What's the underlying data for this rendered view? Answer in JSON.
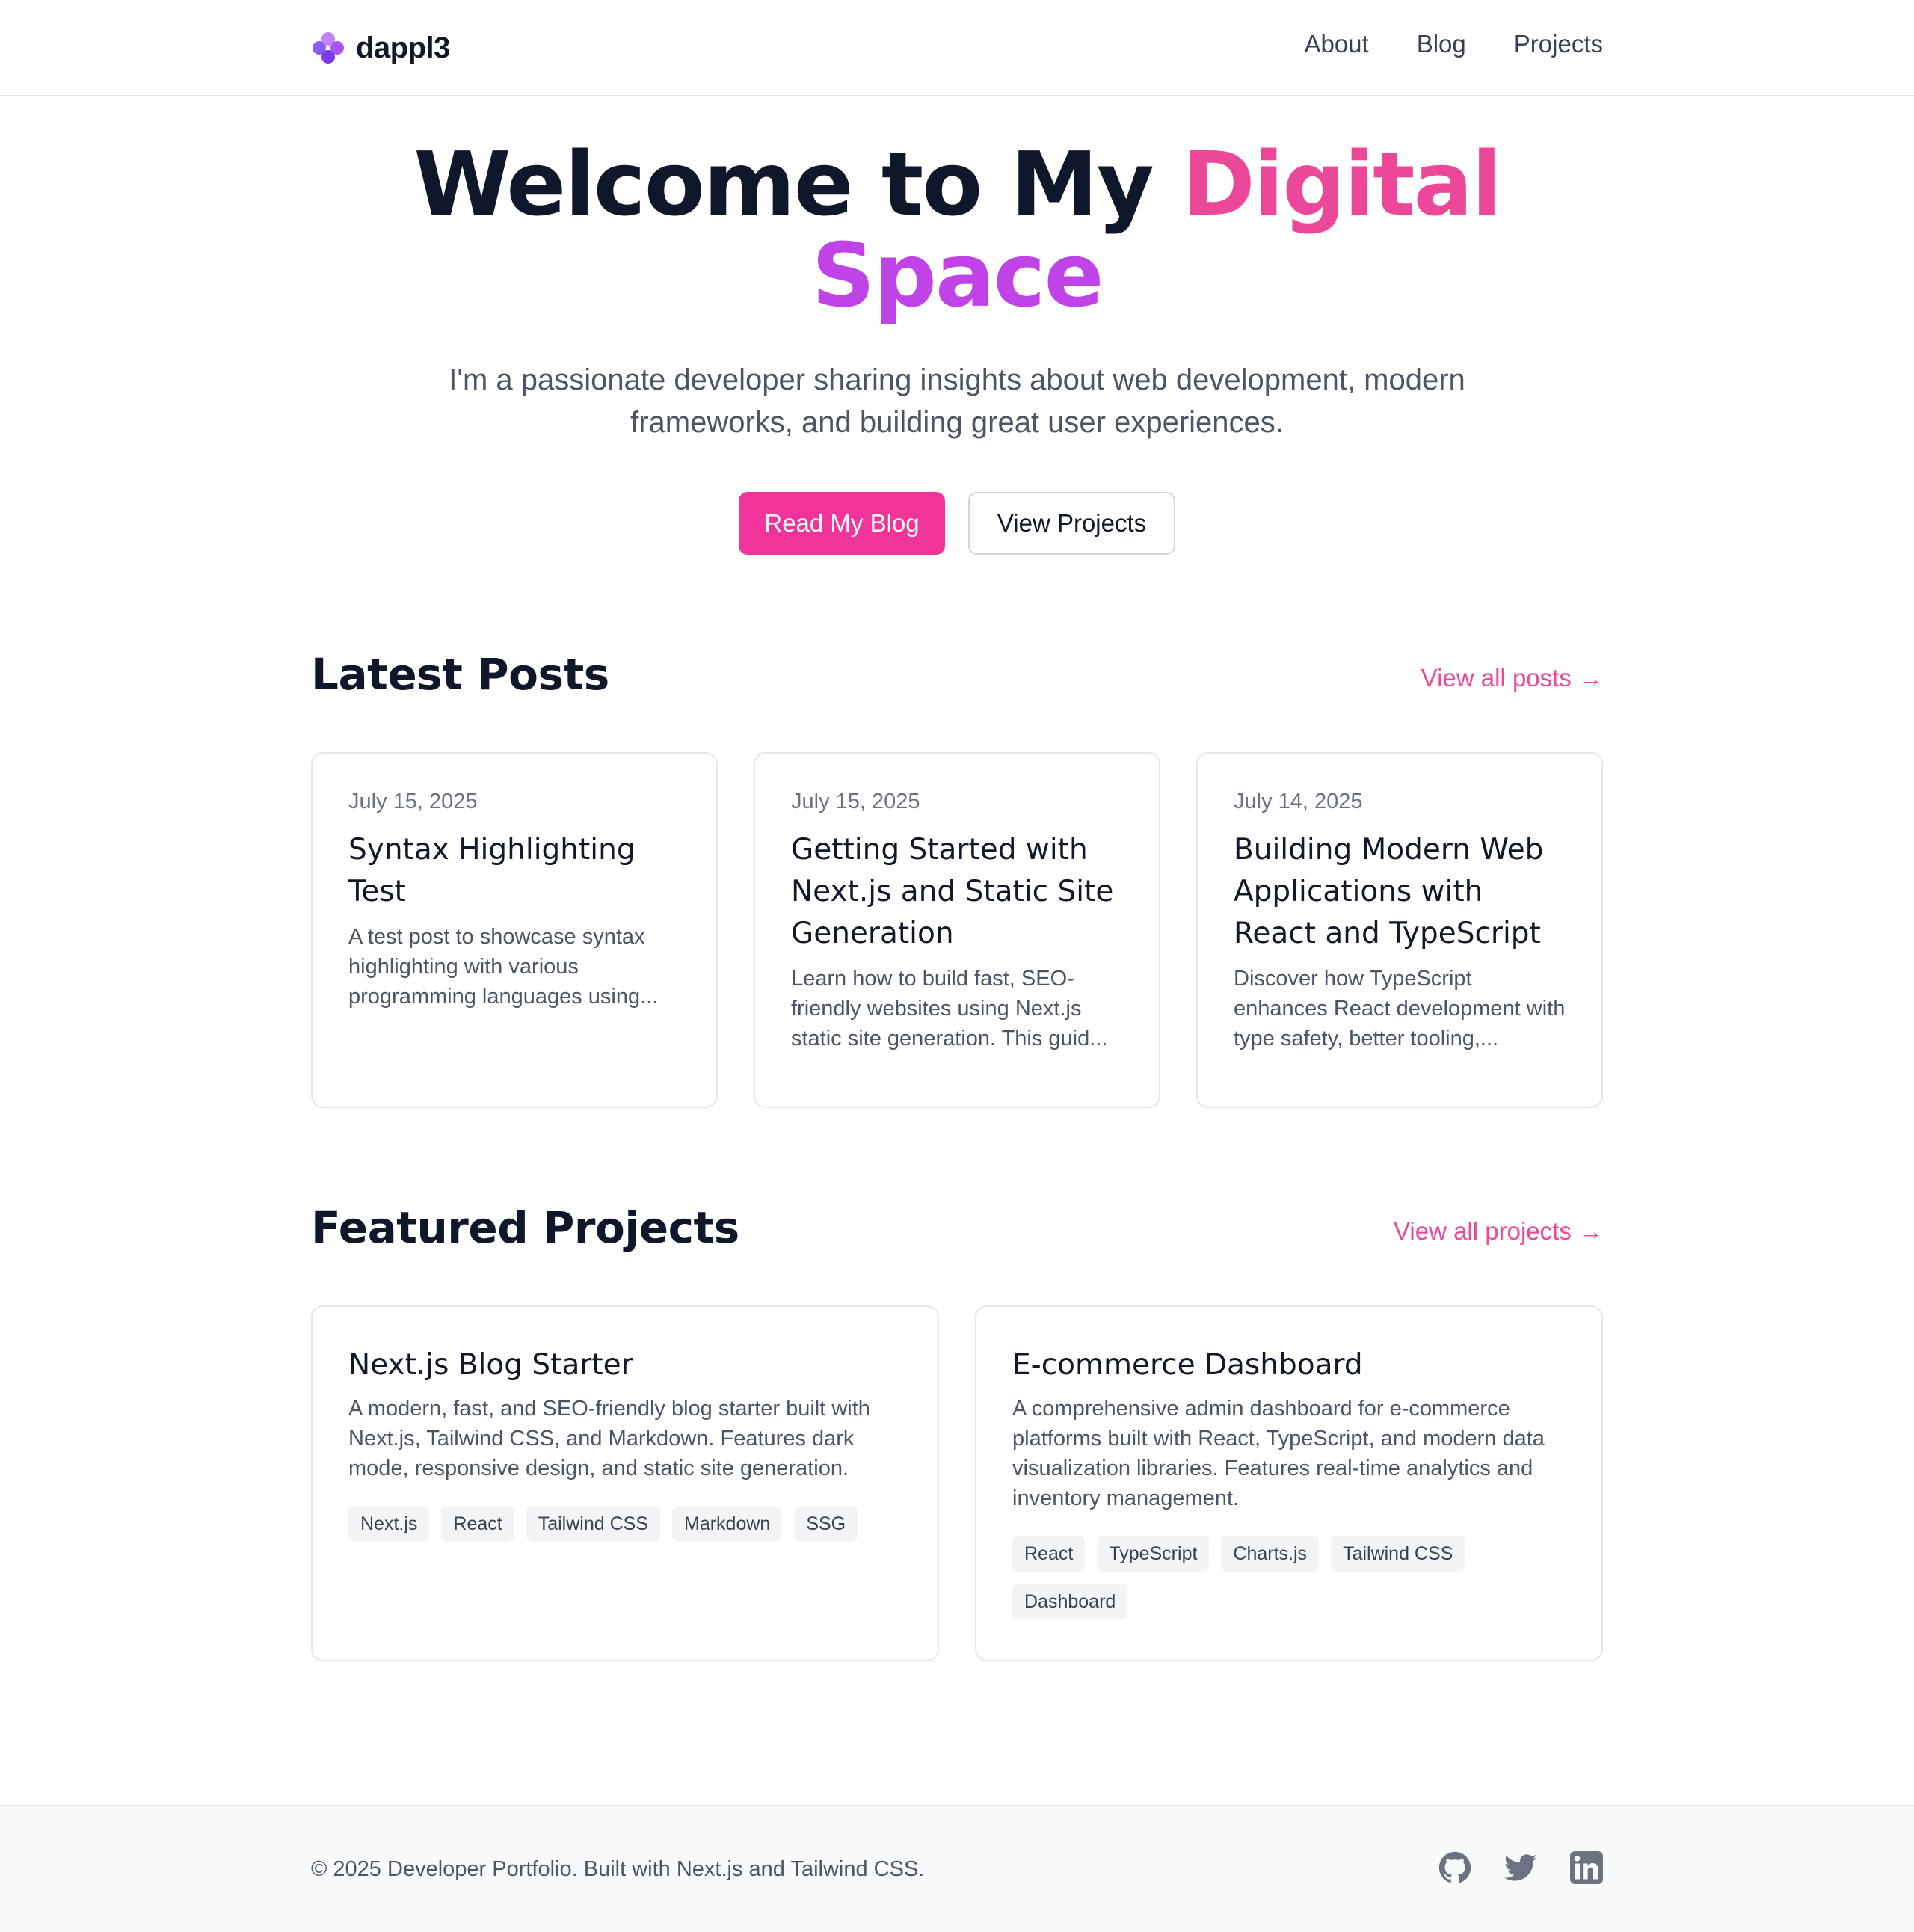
{
  "header": {
    "brand": "dappl3",
    "nav": [
      "About",
      "Blog",
      "Projects"
    ]
  },
  "hero": {
    "title_plain": "Welcome to My ",
    "title_accent1": "Digital",
    "title_accent2": "Space",
    "subtitle": "I'm a passionate developer sharing insights about web development, modern frameworks, and building great user experiences.",
    "primary_button": "Read My Blog",
    "secondary_button": "View Projects"
  },
  "posts": {
    "title": "Latest Posts",
    "view_all": "View all posts →",
    "items": [
      {
        "date": "July 15, 2025",
        "title": "Syntax Highlighting Test",
        "excerpt": "A test post to showcase syntax highlighting with various programming languages using..."
      },
      {
        "date": "July 15, 2025",
        "title": "Getting Started with Next.js and Static Site Generation",
        "excerpt": "Learn how to build fast, SEO-friendly websites using Next.js static site generation. This guid..."
      },
      {
        "date": "July 14, 2025",
        "title": "Building Modern Web Applications with React and TypeScript",
        "excerpt": "Discover how TypeScript enhances React development with type safety, better tooling,..."
      }
    ]
  },
  "projects": {
    "title": "Featured Projects",
    "view_all": "View all projects →",
    "items": [
      {
        "title": "Next.js Blog Starter",
        "description": "A modern, fast, and SEO-friendly blog starter built with Next.js, Tailwind CSS, and Markdown. Features dark mode, responsive design, and static site generation.",
        "tags": [
          "Next.js",
          "React",
          "Tailwind CSS",
          "Markdown",
          "SSG"
        ]
      },
      {
        "title": "E-commerce Dashboard",
        "description": "A comprehensive admin dashboard for e-commerce platforms built with React, TypeScript, and modern data visualization libraries. Features real-time analytics and inventory management.",
        "tags": [
          "React",
          "TypeScript",
          "Charts.js",
          "Tailwind CSS",
          "Dashboard"
        ]
      }
    ]
  },
  "footer": {
    "copyright": "© 2025 Developer Portfolio. Built with Next.js and Tailwind CSS.",
    "socials": [
      "github-icon",
      "twitter-icon",
      "linkedin-icon"
    ]
  },
  "colors": {
    "accent": "#ec4899",
    "accent_purple": "#c043e8",
    "text_dark": "#0f172a"
  }
}
